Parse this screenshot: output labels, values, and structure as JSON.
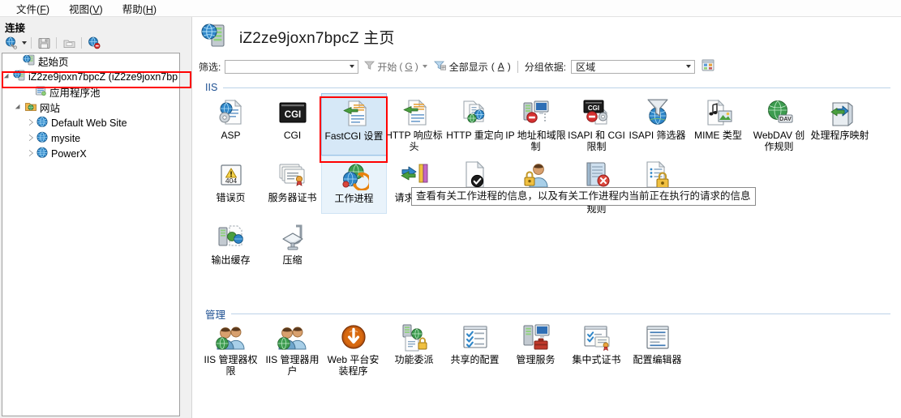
{
  "menubar": {
    "items": [
      {
        "label": "文件",
        "accel": "F"
      },
      {
        "label": "视图",
        "accel": "V"
      },
      {
        "label": "帮助",
        "accel": "H"
      }
    ]
  },
  "sidebar": {
    "title": "连接",
    "toolbar": [
      {
        "name": "connect-to-icon",
        "tip": "连接至"
      },
      {
        "name": "save-icon",
        "tip": "保存"
      },
      {
        "name": "export-icon",
        "tip": "导出"
      },
      {
        "name": "disconnect-icon",
        "tip": "断开连接"
      }
    ],
    "tree": [
      {
        "label": "起始页",
        "icon": "start-page-icon",
        "depth": 0,
        "expander": "none"
      },
      {
        "label": "iZ2ze9joxn7bpcZ (iZ2ze9joxn7bp",
        "icon": "server-icon",
        "depth": 0,
        "expander": "open",
        "highlighted": true
      },
      {
        "label": "应用程序池",
        "icon": "app-pool-icon",
        "depth": 1,
        "expander": "none"
      },
      {
        "label": "网站",
        "icon": "sites-folder-icon",
        "depth": 1,
        "expander": "open"
      },
      {
        "label": "Default Web Site",
        "icon": "globe-icon",
        "depth": 2,
        "expander": "closed"
      },
      {
        "label": "mysite",
        "icon": "globe-icon",
        "depth": 2,
        "expander": "closed"
      },
      {
        "label": "PowerX",
        "icon": "globe-icon",
        "depth": 2,
        "expander": "closed"
      }
    ]
  },
  "header": {
    "title": "iZ2ze9joxn7bpcZ 主页",
    "icon": "server-home-icon"
  },
  "filterbar": {
    "filter_label": "筛选:",
    "filter_value": "",
    "filter_placeholder": "",
    "go_label": "开始",
    "go_accel": "G",
    "show_all_label": "全部显示",
    "show_all_accel": "A",
    "group_by_label": "分组依据:",
    "group_by_value": "区域",
    "view_icon": "view-mode-icon"
  },
  "groups": [
    {
      "name": "IIS"
    },
    {
      "name": "管理"
    }
  ],
  "iis_tiles": [
    {
      "label": "ASP",
      "icon": "asp-icon"
    },
    {
      "label": "CGI",
      "icon": "cgi-icon"
    },
    {
      "label": "FastCGI 设置",
      "icon": "fastcgi-settings-icon",
      "selected": true
    },
    {
      "label": "HTTP 响应标头",
      "icon": "http-response-headers-icon"
    },
    {
      "label": "HTTP 重定向",
      "icon": "http-redirect-icon"
    },
    {
      "label": "IP 地址和域限制",
      "icon": "ip-domain-restrictions-icon"
    },
    {
      "label": "ISAPI 和 CGI 限制",
      "icon": "isapi-cgi-restrictions-icon"
    },
    {
      "label": "ISAPI 筛选器",
      "icon": "isapi-filters-icon"
    },
    {
      "label": "MIME 类型",
      "icon": "mime-types-icon"
    },
    {
      "label": "WebDAV 创作规则",
      "icon": "webdav-authoring-rules-icon"
    },
    {
      "label": "处理程序映射",
      "icon": "handler-mappings-icon"
    },
    {
      "label": "错误页",
      "icon": "error-pages-icon"
    },
    {
      "label": "服务器证书",
      "icon": "server-certificates-icon"
    },
    {
      "label": "工作进程",
      "icon": "worker-processes-icon",
      "hovered": true
    },
    {
      "label": "请求筛选",
      "icon": "request-filtering-icon"
    },
    {
      "label": "日志",
      "icon": "logging-icon"
    },
    {
      "label": "输出缓存",
      "icon": "output-caching-icon"
    },
    {
      "label": "压缩",
      "icon": "compression-icon"
    },
    {
      "label": "身份验证",
      "icon": "authentication-icon"
    },
    {
      "label": "失败请求跟踪规则",
      "icon": "failed-request-tracing-icon"
    },
    {
      "label": "授权规则",
      "icon": "authorization-rules-icon"
    }
  ],
  "mgmt_tiles": [
    {
      "label": "IIS 管理器权限",
      "icon": "iis-manager-permissions-icon"
    },
    {
      "label": "IIS 管理器用户",
      "icon": "iis-manager-users-icon"
    },
    {
      "label": "Web 平台安装程序",
      "icon": "web-platform-installer-icon"
    },
    {
      "label": "功能委派",
      "icon": "feature-delegation-icon"
    },
    {
      "label": "共享的配置",
      "icon": "shared-configuration-icon"
    },
    {
      "label": "管理服务",
      "icon": "management-service-icon"
    },
    {
      "label": "集中式证书",
      "icon": "centralized-certificates-icon"
    },
    {
      "label": "配置编辑器",
      "icon": "configuration-editor-icon"
    }
  ],
  "tooltip": {
    "text": "查看有关工作进程的信息，以及有关工作进程内当前正在执行的请求的信息"
  },
  "annotations": [
    {
      "name": "sidebar-server-node-highlight",
      "color": "#ff0000"
    },
    {
      "name": "fastcgi-tile-highlight",
      "color": "#ff0000"
    }
  ],
  "colors": {
    "accent": "#1d4f91",
    "selection": "#d6e8f7",
    "annotation": "#ff0000"
  }
}
